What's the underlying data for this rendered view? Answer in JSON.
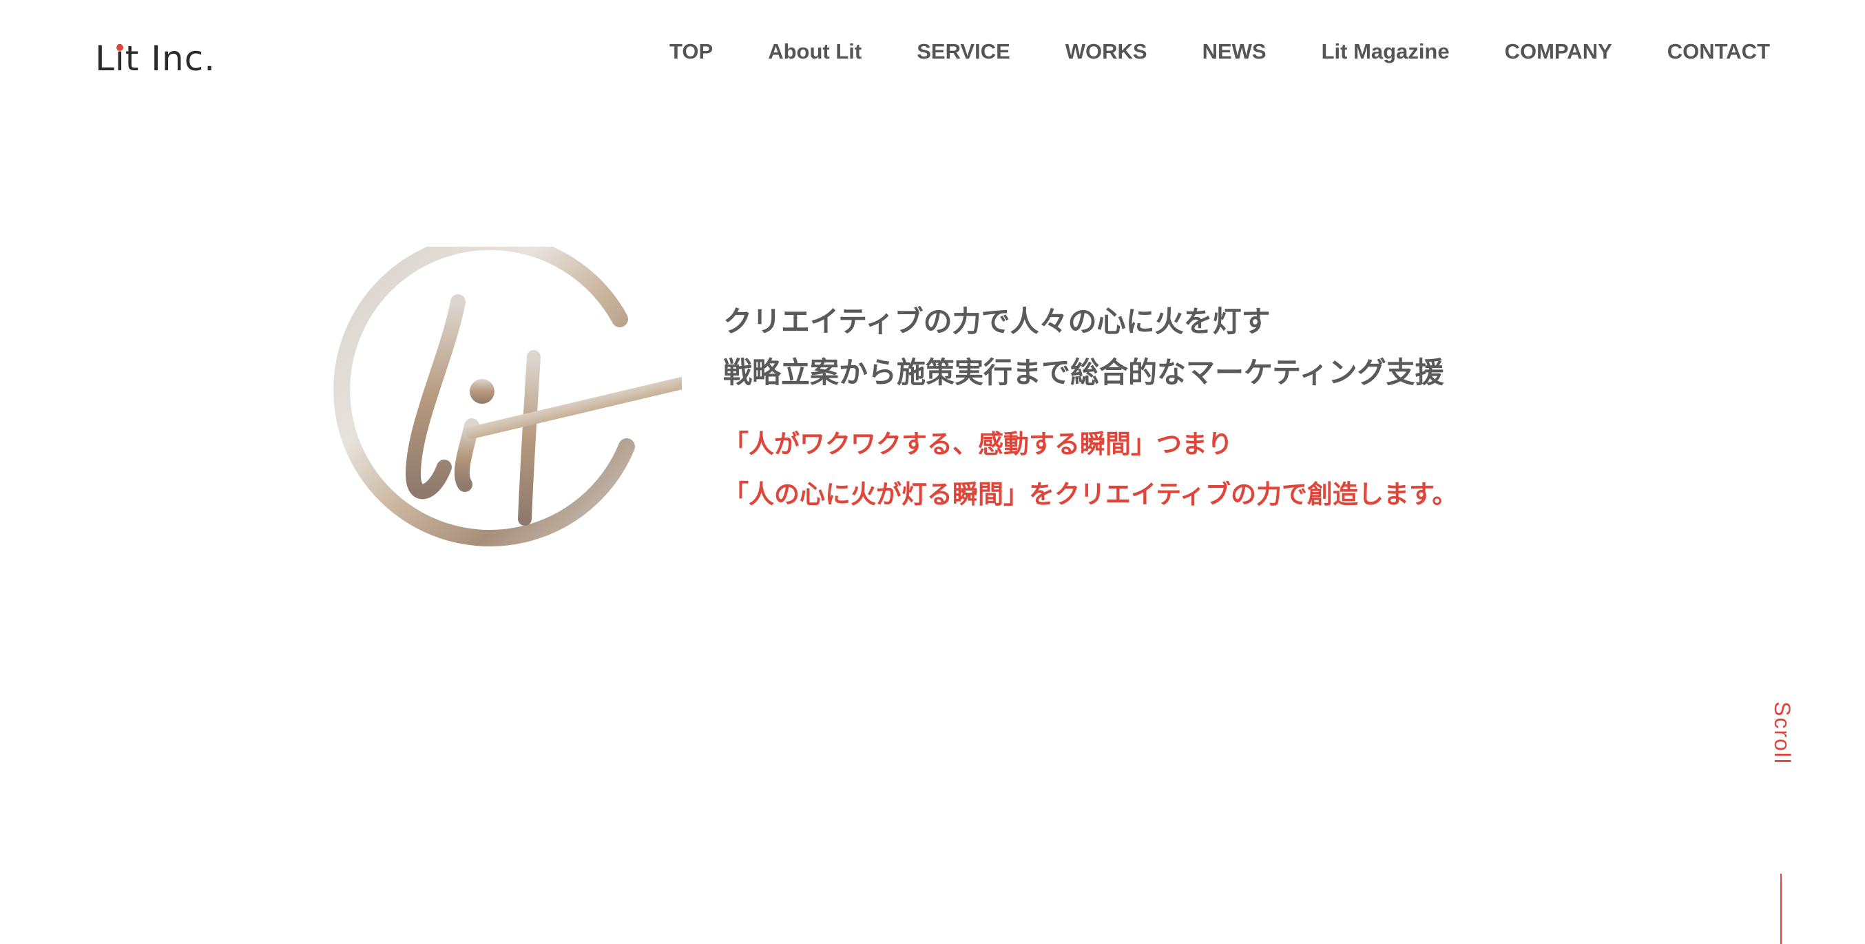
{
  "brand": {
    "logo_text_lead": "L",
    "logo_text_i": "i",
    "logo_text_rest": "t Inc.",
    "accent_color": "#e0453a"
  },
  "nav": {
    "items": [
      {
        "label": "TOP"
      },
      {
        "label": "About Lit"
      },
      {
        "label": "SERVICE"
      },
      {
        "label": "WORKS"
      },
      {
        "label": "NEWS"
      },
      {
        "label": "Lit Magazine"
      },
      {
        "label": "COMPANY"
      },
      {
        "label": "CONTACT"
      }
    ]
  },
  "hero": {
    "headline_line1": "クリエイティブの力で人々の心に火を灯す",
    "headline_line2": "戦略立案から施策実行まで総合的なマーケティング支援",
    "tagline_line1": "「人がワクワクする、感動する瞬間」つまり",
    "tagline_line2": "「人の心に火が灯る瞬間」をクリエイティブの力で創造します。"
  },
  "scroll": {
    "label": "Scroll"
  }
}
